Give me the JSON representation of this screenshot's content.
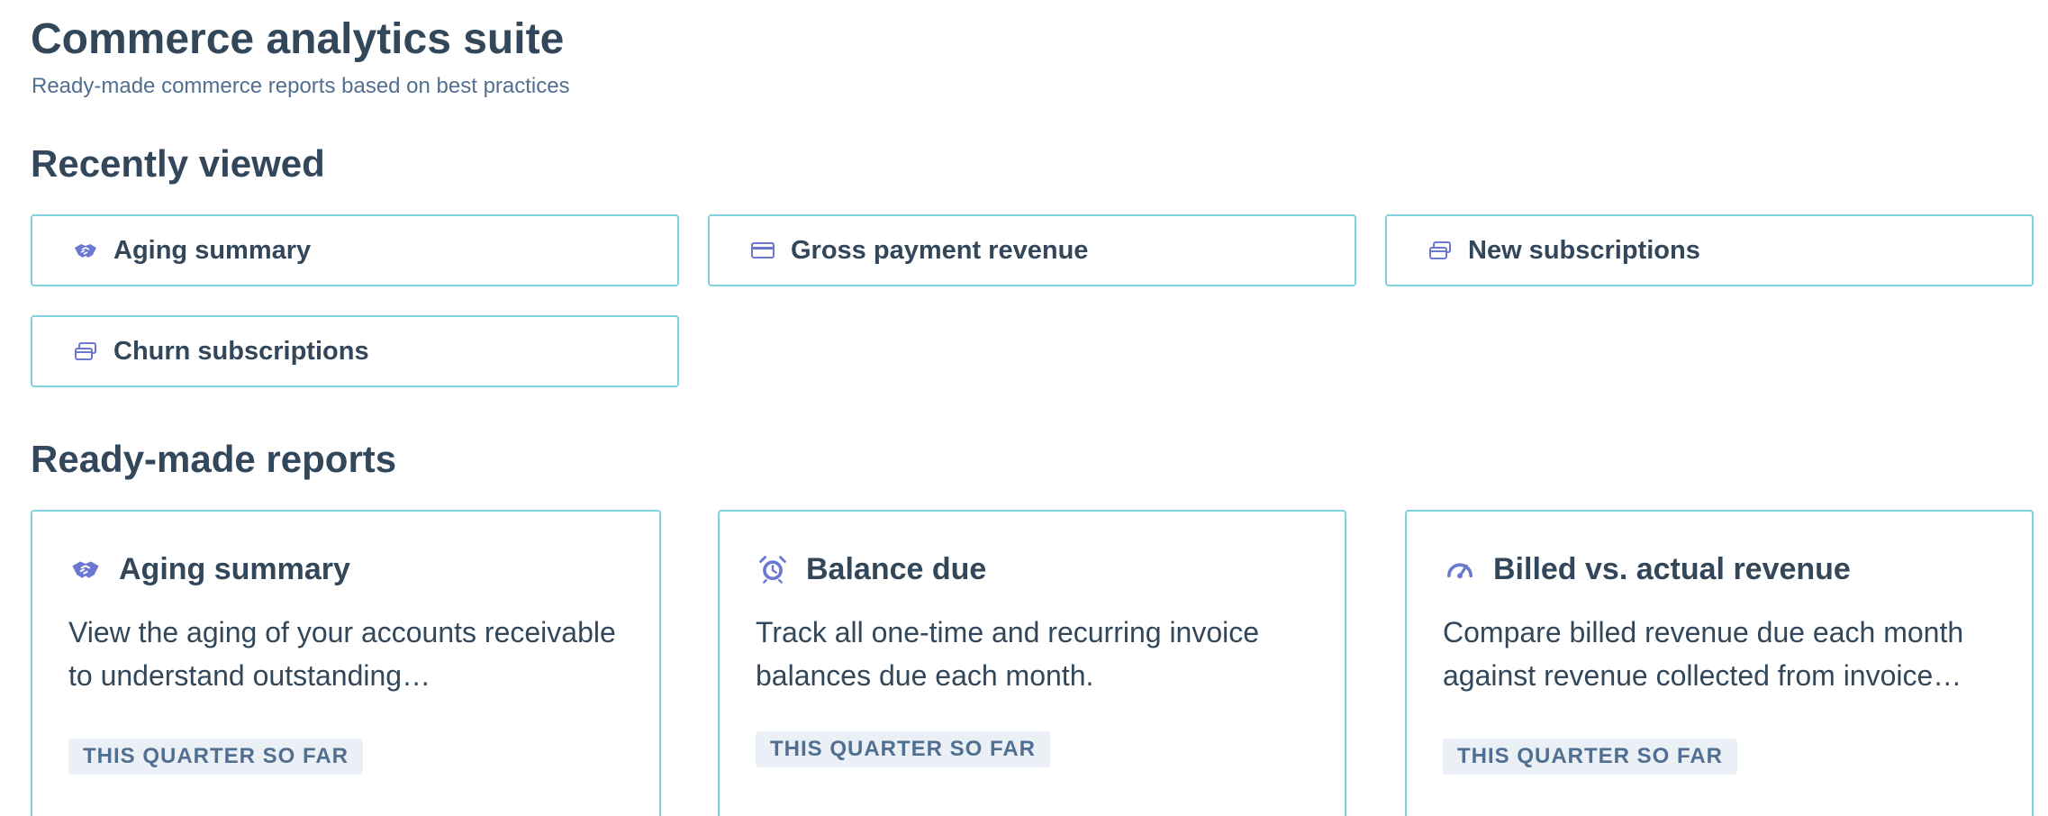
{
  "header": {
    "title": "Commerce analytics suite",
    "subtitle": "Ready-made commerce reports based on best practices"
  },
  "recently_viewed": {
    "heading": "Recently viewed",
    "items": [
      {
        "label": "Aging summary",
        "icon": "handshake-icon"
      },
      {
        "label": "Gross payment revenue",
        "icon": "credit-card-icon"
      },
      {
        "label": "New subscriptions",
        "icon": "subscription-cards-icon"
      },
      {
        "label": "Churn subscriptions",
        "icon": "subscription-cards-icon"
      }
    ]
  },
  "ready_made_reports": {
    "heading": "Ready-made reports",
    "cards": [
      {
        "title": "Aging summary",
        "icon": "handshake-icon",
        "description": "View the aging of your accounts receivable to understand outstanding…",
        "badge": "THIS QUARTER SO FAR"
      },
      {
        "title": "Balance due",
        "icon": "alarm-clock-icon",
        "description": "Track all one-time and recurring invoice balances due each month.",
        "badge": "THIS QUARTER SO FAR"
      },
      {
        "title": "Billed vs. actual revenue",
        "icon": "speedometer-icon",
        "description": "Compare billed revenue due each month against revenue collected from invoice…",
        "badge": "THIS QUARTER SO FAR"
      }
    ]
  },
  "colors": {
    "text": "#33475b",
    "subtext": "#516f90",
    "card_border": "#7fd1de",
    "icon_accent": "#6a78d1",
    "badge_bg": "#eaf0f6"
  }
}
